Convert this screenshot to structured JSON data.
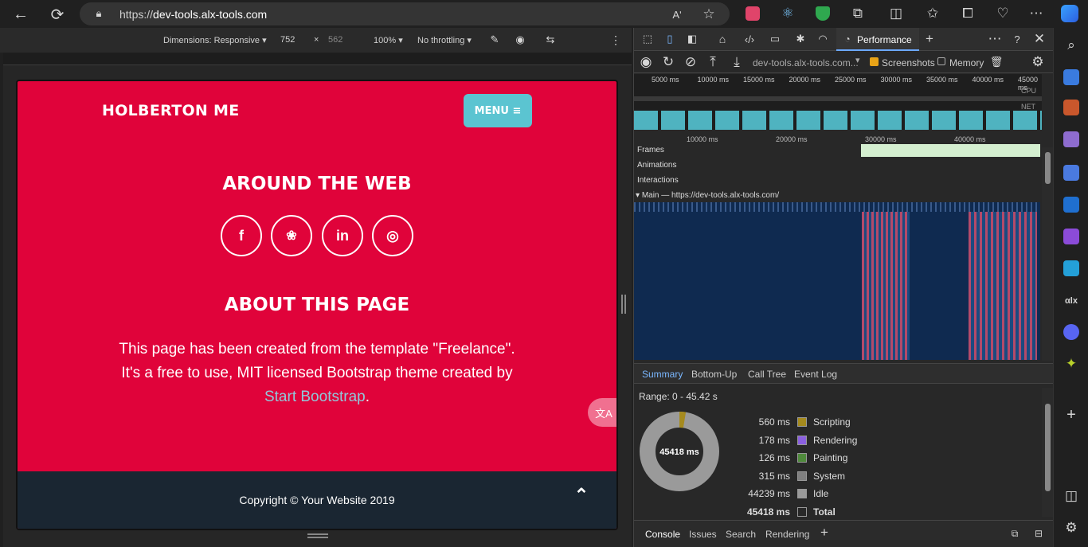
{
  "browser": {
    "url_prefix": "https://",
    "url_domain": "dev-tools.alx-tools.com",
    "read_aloud": "Aʹ"
  },
  "device_toolbar": {
    "dimensions": "Dimensions: Responsive",
    "width": "752",
    "x": "×",
    "height": "562",
    "zoom": "100%",
    "throttling": "No throttling"
  },
  "site": {
    "brand": "HOLBERTON ME",
    "menu": "MENU",
    "around_title": "AROUND THE WEB",
    "social": [
      {
        "name": "facebook",
        "glyph": "f"
      },
      {
        "name": "twitter",
        "glyph": "❀"
      },
      {
        "name": "linkedin",
        "glyph": "in"
      },
      {
        "name": "dribbble",
        "glyph": "◎"
      }
    ],
    "about_title": "ABOUT THIS PAGE",
    "about_line1": "This page has been created from the template \"Freelance\".",
    "about_line2": "It's a free to use, MIT licensed Bootstrap theme created by",
    "about_link": "Start Bootstrap",
    "about_end": ".",
    "copyright": "Copyright © Your Website 2019",
    "translate": "文A"
  },
  "devtools": {
    "performance_tab": "Performance",
    "recording": "dev-tools.alx-tools.com...",
    "screenshots": "Screenshots",
    "memory": "Memory",
    "overview_ticks": [
      "5000 ms",
      "10000 ms",
      "15000 ms",
      "20000 ms",
      "25000 ms",
      "30000 ms",
      "35000 ms",
      "40000 ms",
      "45000 ms"
    ],
    "cpu": "CPU",
    "net": "NET",
    "timeline_ticks": [
      "10000 ms",
      "20000 ms",
      "30000 ms",
      "40000 ms"
    ],
    "tracks": [
      "Frames",
      "Animations",
      "Interactions"
    ],
    "main_track": "Main — https://dev-tools.alx-tools.com/",
    "bottom_tabs": [
      "Summary",
      "Bottom-Up",
      "Call Tree",
      "Event Log"
    ],
    "range": "Range: 0 - 45.42 s",
    "total_ms": "45418 ms",
    "legend": [
      {
        "value": "560 ms",
        "label": "Scripting",
        "color": "#a58a1e"
      },
      {
        "value": "178 ms",
        "label": "Rendering",
        "color": "#8b60e0"
      },
      {
        "value": "126 ms",
        "label": "Painting",
        "color": "#4f8a3c"
      },
      {
        "value": "315 ms",
        "label": "System",
        "color": "#808080"
      },
      {
        "value": "44239 ms",
        "label": "Idle",
        "color": "#9a9a9a"
      },
      {
        "value": "45418 ms",
        "label": "Total",
        "color": "#282828"
      }
    ],
    "drawer_tabs": [
      "Console",
      "Issues",
      "Search",
      "Rendering"
    ]
  }
}
